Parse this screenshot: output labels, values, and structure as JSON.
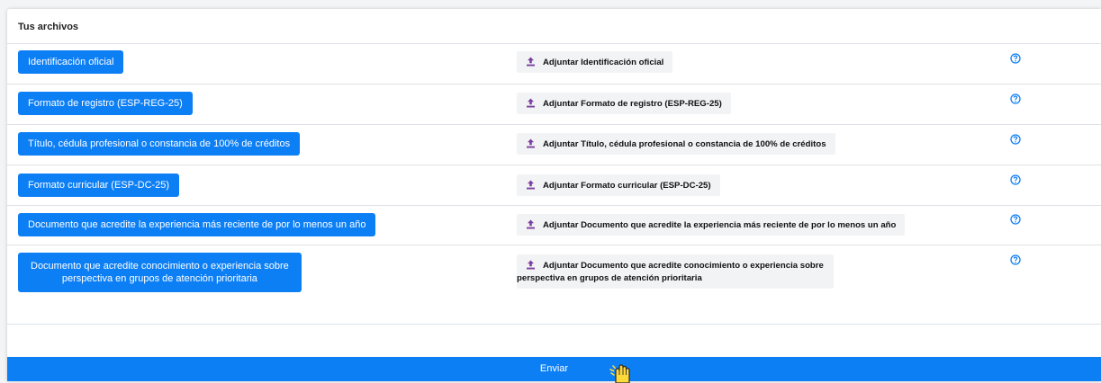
{
  "section_title": "Tus archivos",
  "documents": [
    {
      "label": "Identificación oficial",
      "attach_label": "Adjuntar Identificación oficial"
    },
    {
      "label": "Formato de registro (ESP-REG-25)",
      "attach_label": "Adjuntar Formato de registro (ESP-REG-25)"
    },
    {
      "label": "Título, cédula profesional o constancia de 100% de créditos",
      "attach_label": "Adjuntar Título, cédula profesional o constancia de 100% de créditos"
    },
    {
      "label": "Formato curricular (ESP-DC-25)",
      "attach_label": "Adjuntar Formato curricular (ESP-DC-25)"
    },
    {
      "label": "Documento que acredite la experiencia más reciente de por lo menos un año",
      "attach_label": "Adjuntar Documento que acredite la experiencia más reciente de por lo menos un año"
    },
    {
      "label_line1": "Documento que acredite conocimiento o experiencia sobre",
      "label_line2": "perspectiva en grupos de atención prioritaria",
      "attach_line1": "Adjuntar Documento que acredite conocimiento o experiencia sobre",
      "attach_line2": "perspectiva en grupos de atención prioritaria"
    }
  ],
  "submit_label": "Enviar",
  "colors": {
    "primary": "#0d7ff5",
    "upload_icon": "#7b3fa0",
    "help_icon": "#0d7ff5"
  },
  "icons": {
    "attach": "upload-icon",
    "help": "question-circle-icon",
    "cursor": "hand-pointer-icon"
  }
}
